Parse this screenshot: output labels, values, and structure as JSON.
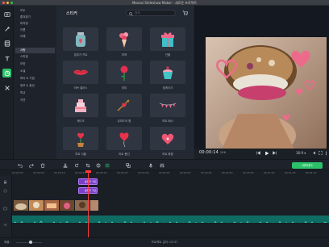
{
  "window": {
    "title": "Movavi Slideshow Maker - 새로운 프로젝트"
  },
  "tools": [
    "import-icon",
    "wand-icon",
    "film-icon",
    "titles-icon",
    "stickers-icon",
    "tools-icon"
  ],
  "categories": [
    {
      "label": "모두"
    },
    {
      "label": "즐겨찾기"
    },
    {
      "label": "피처링"
    },
    {
      "label": "이름"
    },
    {
      "label": "이해"
    },
    {
      "label": "사랑",
      "selected": true
    },
    {
      "label": "스마일"
    },
    {
      "label": "모양"
    },
    {
      "label": "소셜"
    },
    {
      "label": "파티 & 기념"
    },
    {
      "label": "정보 & 옵션"
    },
    {
      "label": "학교"
    },
    {
      "label": "자연"
    }
  ],
  "stickers_panel": {
    "title": "스티커",
    "search_placeholder": "검색",
    "items": [
      {
        "label": "분위기 키트",
        "icon": "jar-icon"
      },
      {
        "label": "부케",
        "icon": "bouquet-icon"
      },
      {
        "label": "선물",
        "icon": "gift-icon"
      },
      {
        "label": "러브 셀러스",
        "icon": "lips-icon"
      },
      {
        "label": "장미",
        "icon": "rose-icon"
      },
      {
        "label": "컵케이크",
        "icon": "cupcake-icon"
      },
      {
        "label": "케이크",
        "icon": "cake-icon"
      },
      {
        "label": "큐피드의 활",
        "icon": "cupid-bow-icon"
      },
      {
        "label": "하트 배너",
        "icon": "bunting-icon"
      },
      {
        "label": "하트 식물",
        "icon": "plant-icon"
      },
      {
        "label": "하트 풍선",
        "icon": "balloon-icon"
      },
      {
        "label": "하트 화환",
        "icon": "heart-flower-icon"
      }
    ]
  },
  "player": {
    "time": "00:00:14",
    "frame": "266",
    "progress": 0.09,
    "ratio": "16:9 ▾"
  },
  "editor": {
    "export_label": "내보내기"
  },
  "timeline": {
    "ticks": [
      "00:00:00",
      "00:00:05",
      "00:00:10",
      "00:00:15",
      "00:00:20",
      "00:00:25",
      "00:00:30",
      "00:00:35",
      "00:00:40",
      "00:00:45",
      "00:00:50",
      "00:00:55",
      "00:01:00",
      "00:01:05",
      "00:01:10"
    ],
    "clips": [
      {
        "label": "분위기 키트"
      },
      {
        "label": "분위기 키트"
      }
    ]
  },
  "status": {
    "zoom_label": "배율:",
    "zoom_level": 0.55,
    "duration_label": "프로젝트 길이:",
    "duration": "03:37"
  },
  "colors": {
    "accent": "#2cc069",
    "clip": "#7b3fc8",
    "audio": "#0e6c63",
    "playhead": "#ff3b3b"
  }
}
